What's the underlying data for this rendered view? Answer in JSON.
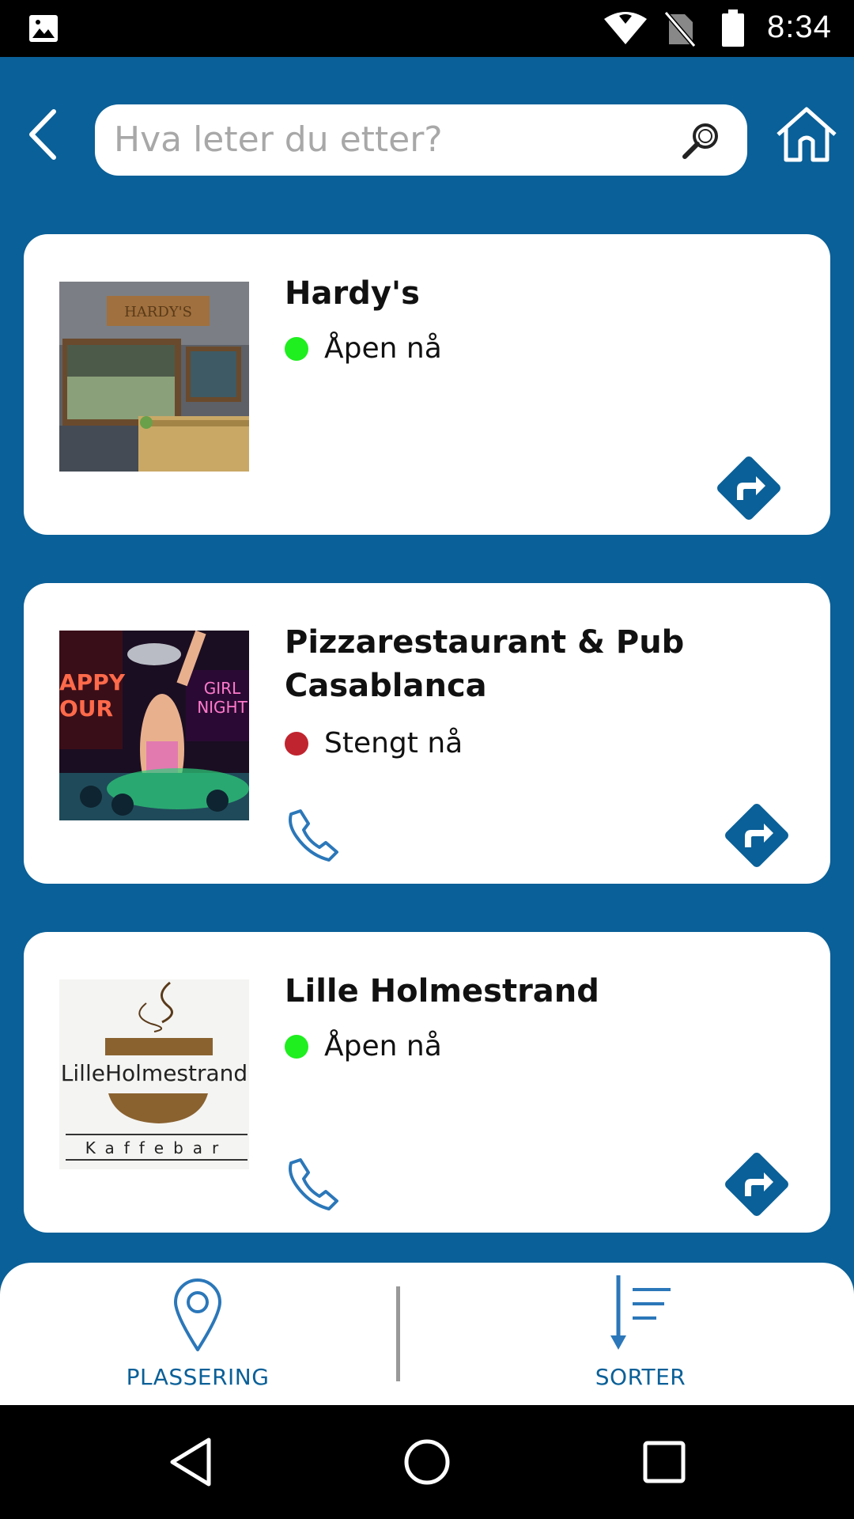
{
  "status_bar": {
    "time": "8:34"
  },
  "search": {
    "placeholder": "Hva leter du etter?"
  },
  "places": [
    {
      "name": "Hardy's",
      "status": "Åpen nå",
      "open": true,
      "status_color": "#1fee1f",
      "has_phone": false
    },
    {
      "name": "Pizzarestaurant & Pub Casablanca",
      "status": "Stengt nå",
      "open": false,
      "status_color": "#c0242e",
      "has_phone": true
    },
    {
      "name": "Lille Holmestrand",
      "status": "Åpen nå",
      "open": true,
      "status_color": "#1fee1f",
      "has_phone": true
    }
  ],
  "thumbnails": {
    "hardys_sign": "HARDY'S",
    "casablanca_left": "APPY OUR",
    "casablanca_right": "GIRL NIGHT",
    "lille_logo": "LilleHolmestrand",
    "lille_sub": "Kaffebar"
  },
  "bottom_bar": {
    "location_label": "PLASSERING",
    "sort_label": "SORTER"
  },
  "colors": {
    "primary": "#0a6098",
    "open": "#1fee1f",
    "closed": "#c0242e",
    "icon_blue": "#2b77b9"
  }
}
